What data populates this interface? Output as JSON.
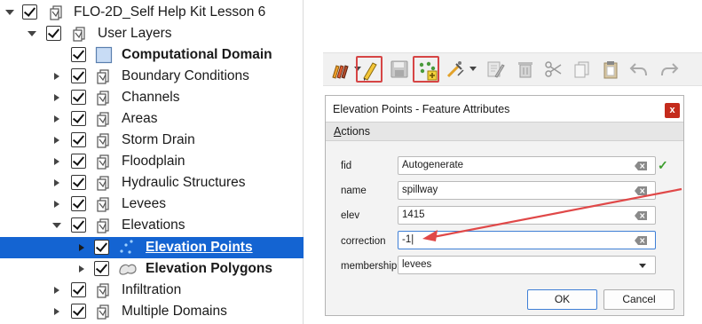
{
  "layer_tree": {
    "items": [
      {
        "label": "FLO-2D_Self Help Kit Lesson 6"
      },
      {
        "label": "User Layers"
      },
      {
        "label": "Computational Domain"
      },
      {
        "label": "Boundary Conditions"
      },
      {
        "label": "Channels"
      },
      {
        "label": "Areas"
      },
      {
        "label": "Storm Drain"
      },
      {
        "label": "Floodplain"
      },
      {
        "label": "Hydraulic Structures"
      },
      {
        "label": "Levees"
      },
      {
        "label": "Elevations"
      },
      {
        "label": "Elevation Points"
      },
      {
        "label": "Elevation Polygons"
      },
      {
        "label": "Infiltration"
      },
      {
        "label": "Multiple Domains"
      }
    ]
  },
  "dialog": {
    "title": "Elevation Points - Feature Attributes",
    "close_label": "x",
    "actions_label_u": "A",
    "actions_label_rest": "ctions",
    "fields": [
      {
        "label": "fid",
        "value": "Autogenerate"
      },
      {
        "label": "name",
        "value": "spillway"
      },
      {
        "label": "elev",
        "value": "1415"
      },
      {
        "label": "correction",
        "value": "-1|"
      },
      {
        "label": "membership",
        "value": "levees"
      }
    ],
    "ok_label": "OK",
    "cancel_label": "Cancel",
    "valid_mark": "✓"
  },
  "colors": {
    "selection": "#1464d2",
    "highlight_border": "#d64545",
    "annotation_arrow": "#e04848",
    "valid_check": "#3b9d2c"
  },
  "icons": {
    "toolbar": [
      "pencil-styles-icon",
      "toggle-editing-icon",
      "save-edits-icon",
      "add-point-feature-icon",
      "vertex-tool-icon",
      "modify-attributes-icon",
      "delete-selected-icon",
      "cut-features-icon",
      "copy-features-icon",
      "paste-features-icon",
      "undo-icon",
      "redo-icon"
    ]
  }
}
